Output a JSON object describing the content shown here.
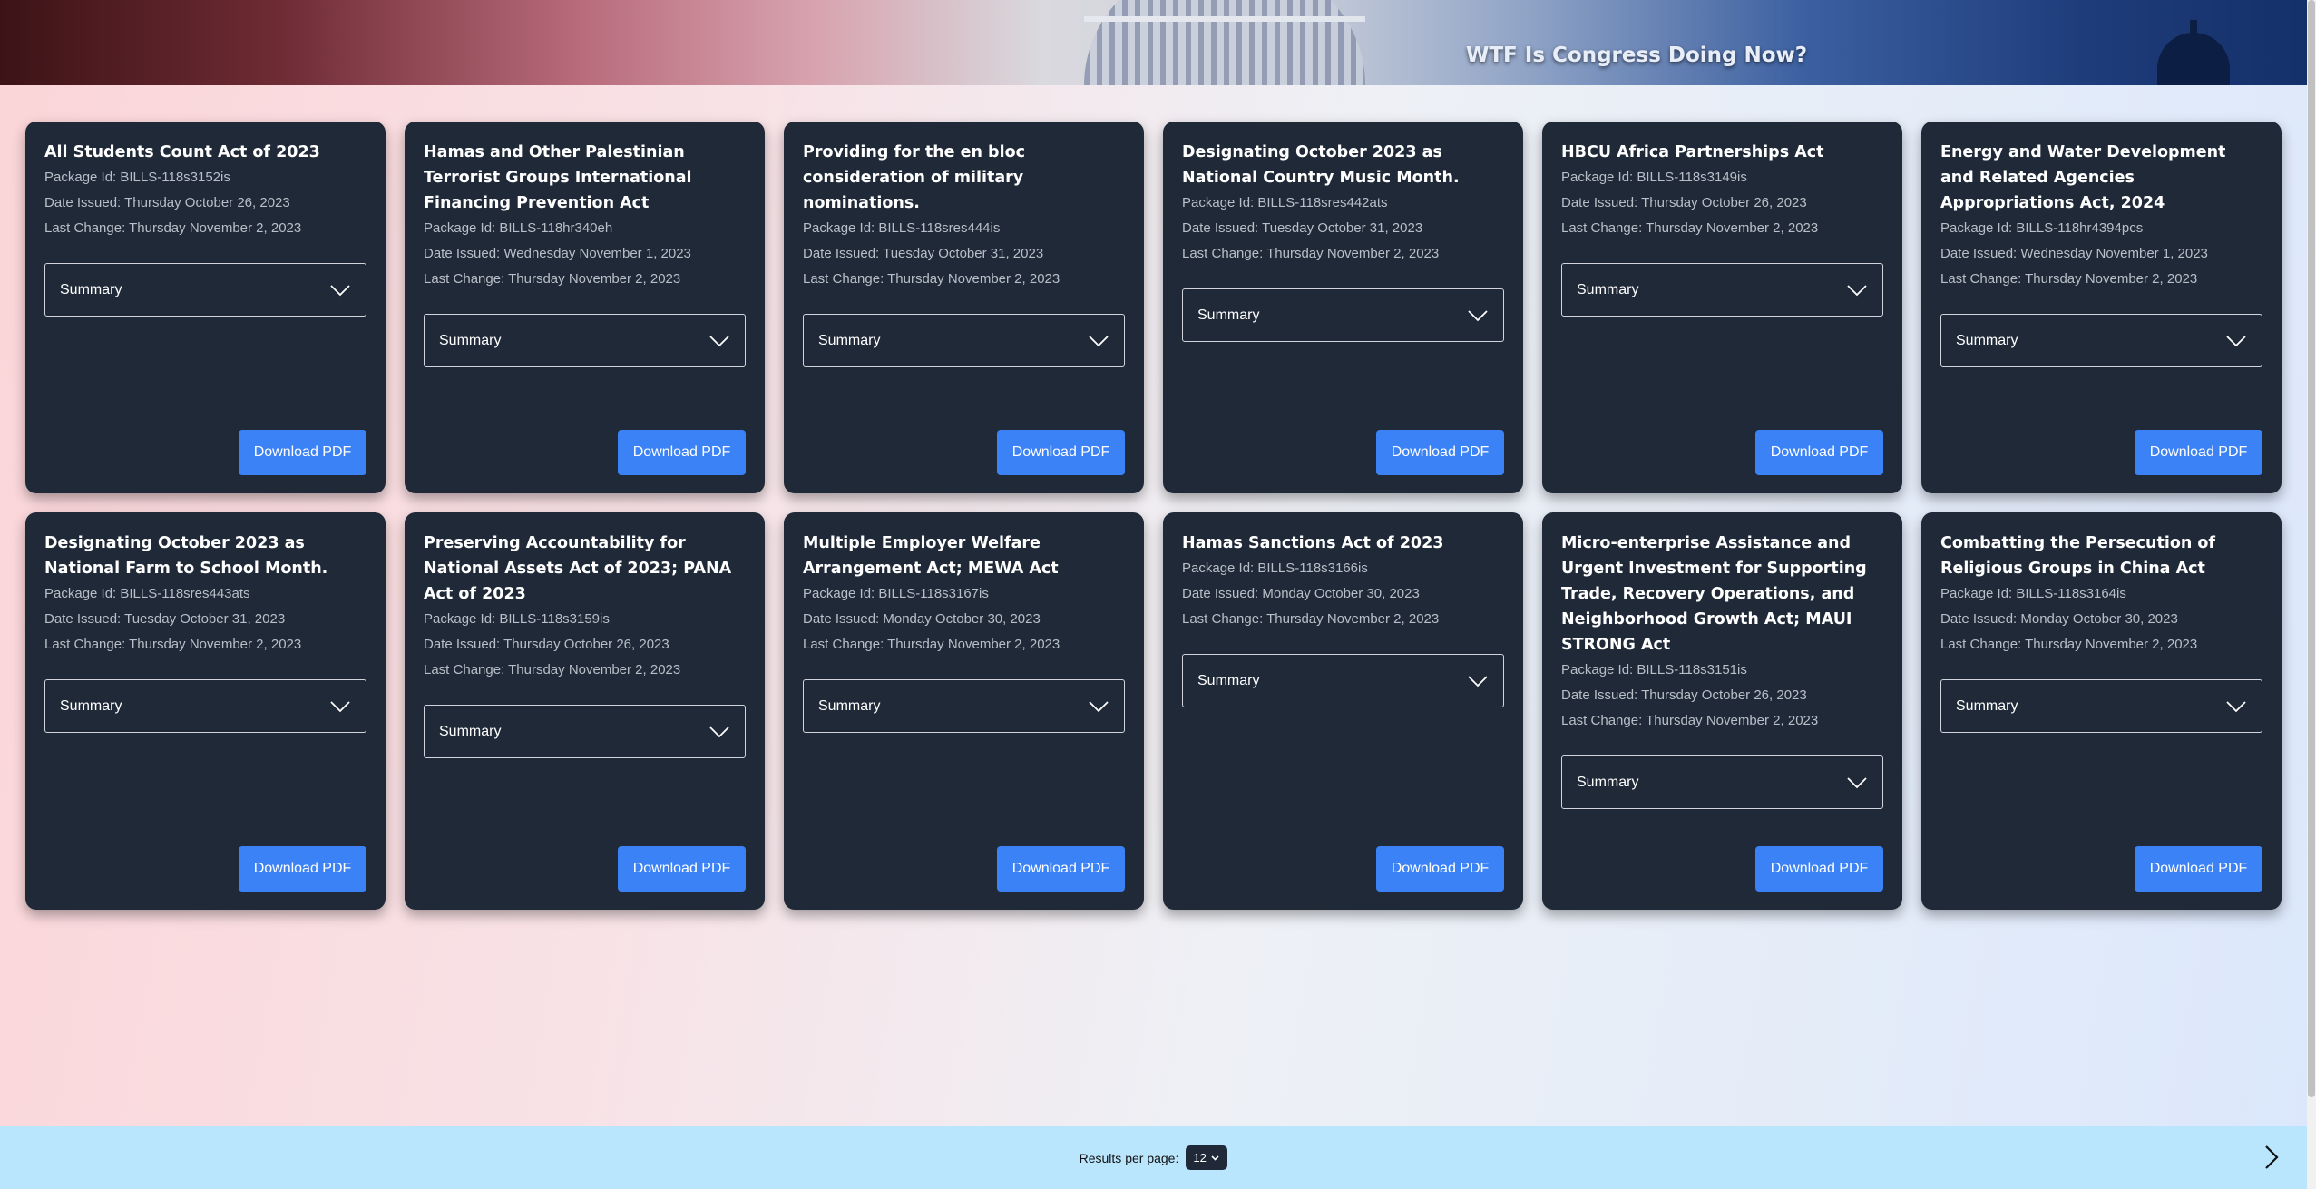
{
  "header": {
    "title": "WTF Is Congress Doing Now?"
  },
  "cards": [
    {
      "title": "All Students Count Act of 2023",
      "package_id": "Package Id: BILLS-118s3152is",
      "date_issued": "Date Issued: Thursday October 26, 2023",
      "last_change": "Last Change: Thursday November 2, 2023",
      "summary_label": "Summary",
      "download_label": "Download PDF"
    },
    {
      "title": "Hamas and Other Palestinian Terrorist Groups International Financing Prevention Act",
      "package_id": "Package Id: BILLS-118hr340eh",
      "date_issued": "Date Issued: Wednesday November 1, 2023",
      "last_change": "Last Change: Thursday November 2, 2023",
      "summary_label": "Summary",
      "download_label": "Download PDF"
    },
    {
      "title": "Providing for the en bloc consideration of military nominations.",
      "package_id": "Package Id: BILLS-118sres444is",
      "date_issued": "Date Issued: Tuesday October 31, 2023",
      "last_change": "Last Change: Thursday November 2, 2023",
      "summary_label": "Summary",
      "download_label": "Download PDF"
    },
    {
      "title": "Designating October 2023 as National Country Music Month.",
      "package_id": "Package Id: BILLS-118sres442ats",
      "date_issued": "Date Issued: Tuesday October 31, 2023",
      "last_change": "Last Change: Thursday November 2, 2023",
      "summary_label": "Summary",
      "download_label": "Download PDF"
    },
    {
      "title": "HBCU Africa Partnerships Act",
      "package_id": "Package Id: BILLS-118s3149is",
      "date_issued": "Date Issued: Thursday October 26, 2023",
      "last_change": "Last Change: Thursday November 2, 2023",
      "summary_label": "Summary",
      "download_label": "Download PDF"
    },
    {
      "title": "Energy and Water Development and Related Agencies Appropriations Act, 2024",
      "package_id": "Package Id: BILLS-118hr4394pcs",
      "date_issued": "Date Issued: Wednesday November 1, 2023",
      "last_change": "Last Change: Thursday November 2, 2023",
      "summary_label": "Summary",
      "download_label": "Download PDF"
    },
    {
      "title": "Designating October 2023 as National Farm to School Month.",
      "package_id": "Package Id: BILLS-118sres443ats",
      "date_issued": "Date Issued: Tuesday October 31, 2023",
      "last_change": "Last Change: Thursday November 2, 2023",
      "summary_label": "Summary",
      "download_label": "Download PDF"
    },
    {
      "title": "Preserving Accountability for National Assets Act of 2023; PANA Act of 2023",
      "package_id": "Package Id: BILLS-118s3159is",
      "date_issued": "Date Issued: Thursday October 26, 2023",
      "last_change": "Last Change: Thursday November 2, 2023",
      "summary_label": "Summary",
      "download_label": "Download PDF"
    },
    {
      "title": "Multiple Employer Welfare Arrangement Act; MEWA Act",
      "package_id": "Package Id: BILLS-118s3167is",
      "date_issued": "Date Issued: Monday October 30, 2023",
      "last_change": "Last Change: Thursday November 2, 2023",
      "summary_label": "Summary",
      "download_label": "Download PDF"
    },
    {
      "title": "Hamas Sanctions Act of 2023",
      "package_id": "Package Id: BILLS-118s3166is",
      "date_issued": "Date Issued: Monday October 30, 2023",
      "last_change": "Last Change: Thursday November 2, 2023",
      "summary_label": "Summary",
      "download_label": "Download PDF"
    },
    {
      "title": "Micro-enterprise Assistance and Urgent Investment for Supporting Trade, Recovery Operations, and Neighborhood Growth Act; MAUI STRONG Act",
      "package_id": "Package Id: BILLS-118s3151is",
      "date_issued": "Date Issued: Thursday October 26, 2023",
      "last_change": "Last Change: Thursday November 2, 2023",
      "summary_label": "Summary",
      "download_label": "Download PDF"
    },
    {
      "title": "Combatting the Persecution of Religious Groups in China Act",
      "package_id": "Package Id: BILLS-118s3164is",
      "date_issued": "Date Issued: Monday October 30, 2023",
      "last_change": "Last Change: Thursday November 2, 2023",
      "summary_label": "Summary",
      "download_label": "Download PDF"
    }
  ],
  "footer": {
    "results_label": "Results per page:",
    "results_value": "12"
  },
  "icons": {
    "dropdown": "chevron-down-icon",
    "next": "chevron-right-icon"
  },
  "colors": {
    "card_bg": "#1f2937",
    "button": "#3b82f6",
    "footer_bg": "#bae6fd"
  }
}
